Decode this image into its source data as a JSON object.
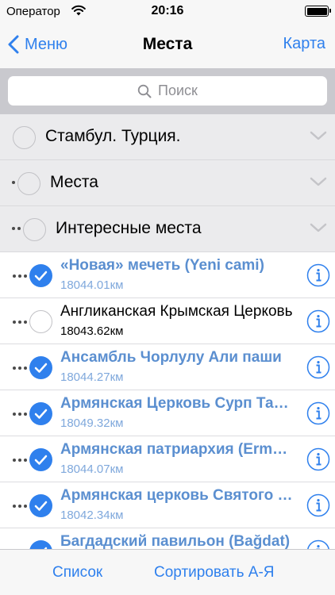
{
  "status_bar": {
    "carrier": "Оператор",
    "time": "20:16"
  },
  "nav": {
    "back_label": "Меню",
    "title": "Места",
    "right_label": "Карта"
  },
  "search": {
    "placeholder": "Поиск"
  },
  "sections": [
    {
      "label": "Стамбул. Турция.",
      "level": 0
    },
    {
      "label": "Места",
      "level": 1
    },
    {
      "label": "Интересные места",
      "level": 2
    }
  ],
  "places": [
    {
      "title": "«Новая» мечеть (Yeni cami)",
      "distance": "18044.01км",
      "selected": true
    },
    {
      "title": "Англиканская Крымская Церковь",
      "distance": "18043.62км",
      "selected": false
    },
    {
      "title": "Ансамбль Чорлулу Али паши",
      "distance": "18044.27км",
      "selected": true
    },
    {
      "title": "Армянская Церковь Сурп Татеос",
      "distance": "18049.32км",
      "selected": true
    },
    {
      "title": "Армянская патриархия (Ermeni)",
      "distance": "18044.07км",
      "selected": true
    },
    {
      "title": "Армянская церковь Святого Георгия",
      "distance": "18042.34км",
      "selected": true
    },
    {
      "title": "Багдадский павильон (Bağdat)",
      "distance": "",
      "selected": true
    }
  ],
  "toolbar": {
    "list_label": "Список",
    "sort_label": "Сортировать А-Я"
  },
  "colors": {
    "accent": "#2f80ed",
    "selected_text": "#5b8fd0",
    "section_bg": "#ebebed"
  }
}
